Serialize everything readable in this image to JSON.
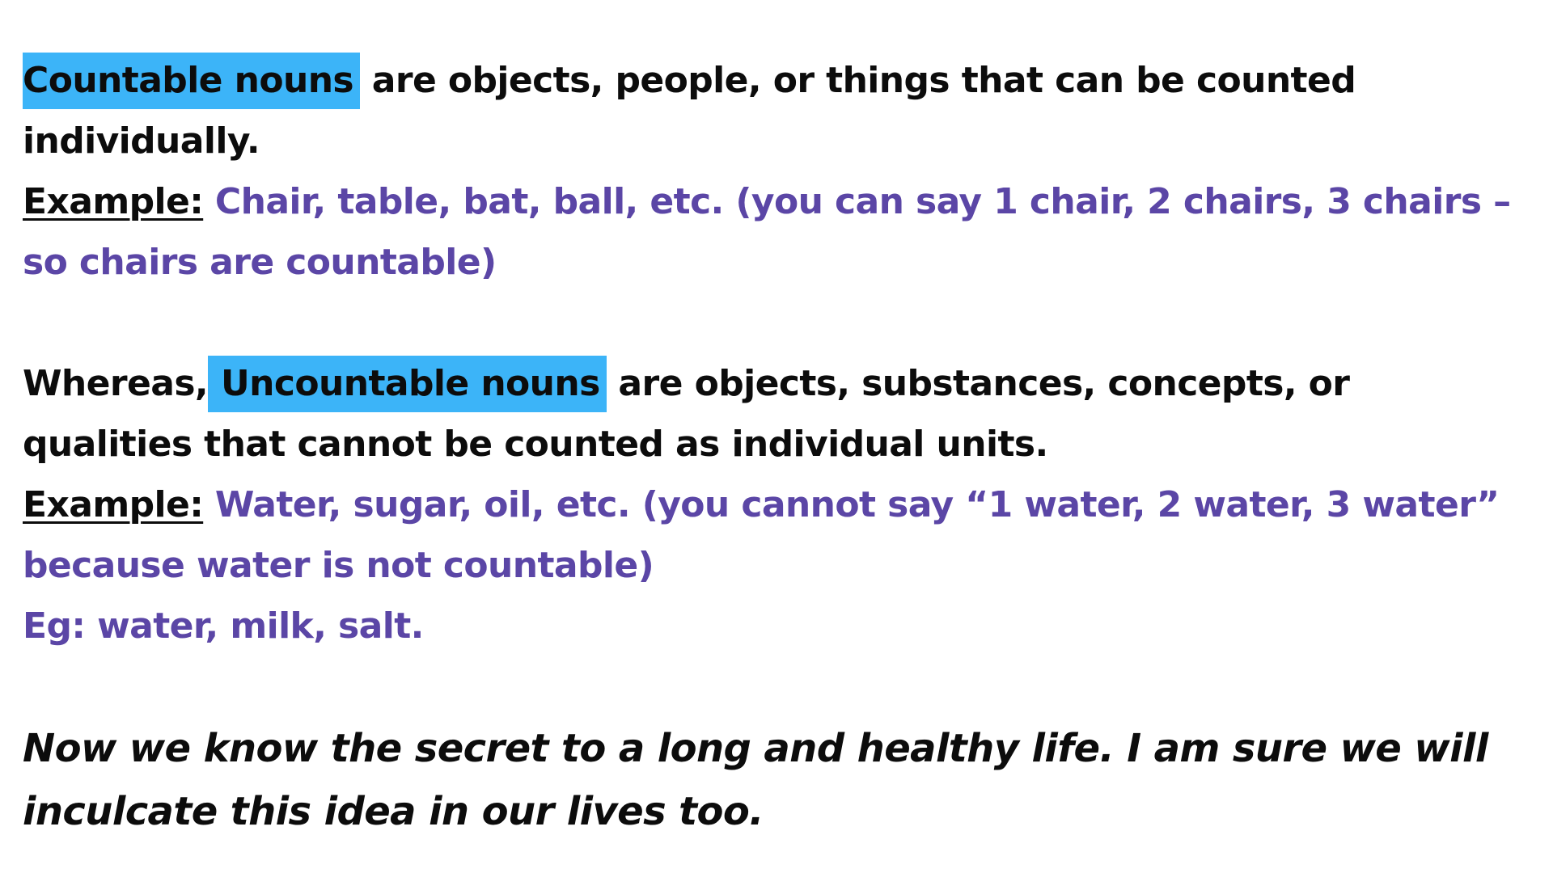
{
  "colors": {
    "highlight": "#3cb4f8",
    "example_text": "#5b46a6",
    "body_text": "#0c0c0c"
  },
  "countable": {
    "term": "Countable nouns",
    "definition": " are objects, people, or things that can be counted individually.",
    "example_label": "Example:",
    "example_text": " Chair, table, bat, ball, etc. (you can say 1 chair, 2 chairs, 3 chairs – so chairs are countable)"
  },
  "uncountable": {
    "lead": "Whereas,",
    "term": "Uncountable nouns",
    "definition": " are objects, substances, concepts, or qualities that cannot be counted as individual units.",
    "example_label": "Example:",
    "example_text": " Water, sugar, oil, etc. (you cannot say “1 water, 2 water, 3 water” because water is not countable)",
    "eg_line": "Eg: water, milk, salt."
  },
  "closing": "Now we know the secret to a long and healthy life. I am sure we will inculcate this idea in our lives too."
}
